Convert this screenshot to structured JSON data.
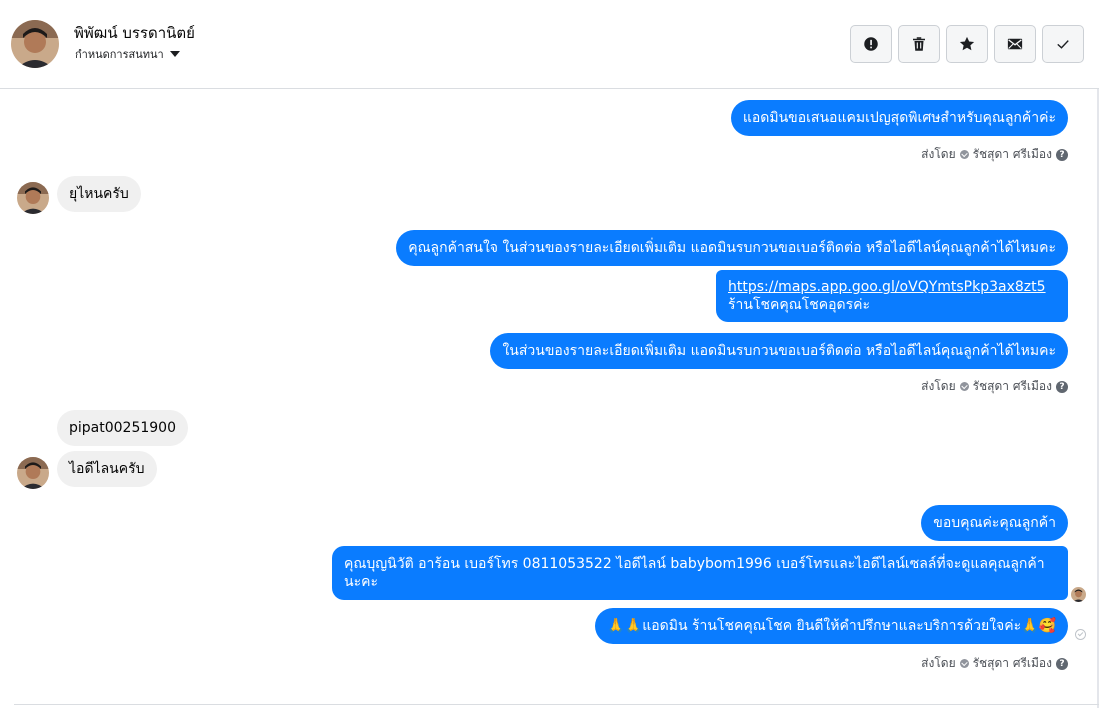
{
  "header": {
    "name": "พิพัฒน์ บรรดานิตย์",
    "subtitle": "กำหนดการสนทนา",
    "actions": [
      "report-icon",
      "trash-icon",
      "star-icon",
      "mail-icon",
      "check-icon"
    ]
  },
  "messages": {
    "m1": "แอดมินขอเสนอแคมเปญสุดพิเศษสำหรับคุณลูกค้าค่ะ",
    "m2": "ยุไหนครับ",
    "m3": "คุณลูกค้าสนใจ ในส่วนของรายละเอียดเพิ่มเติม แอดมินรบกวนขอเบอร์ติดต่อ หรือไอดีไลน์คุณลูกค้าได้ไหมคะ",
    "m4_link": "https://maps.app.goo.gl/oVQYmtsPkp3ax8zt5",
    "m4_text": "ร้านโชคคุณโชคอุดรค่ะ",
    "m5": "ในส่วนของรายละเอียดเพิ่มเติม แอดมินรบกวนขอเบอร์ติดต่อ หรือไอดีไลน์คุณลูกค้าได้ไหมคะ",
    "m6": "pipat00251900",
    "m7": "ไอดีไลนครับ",
    "m8": "ขอบคุณค่ะคุณลูกค้า",
    "m9": "คุณบุญนิวัติ  อาร้อน        เบอร์โทร 0811053522  ไอดีไลน์ babybom1996   เบอร์โทรและไอดีไลน์เซลล์ที่จะดูแลคุณลูกค้านะคะ",
    "m10": "🙏🙏แอดมิน ร้านโชคคุณโชค ยินดีให้คำปรึกษาและบริการด้วยใจค่ะ🙏🥰"
  },
  "sent_by": {
    "prefix": "ส่งโดย",
    "agent": "รัชสุดา ศรีเมือง",
    "help": "?"
  },
  "colors": {
    "outgoing": "#0a7cff",
    "incoming": "#f0f0f0"
  }
}
